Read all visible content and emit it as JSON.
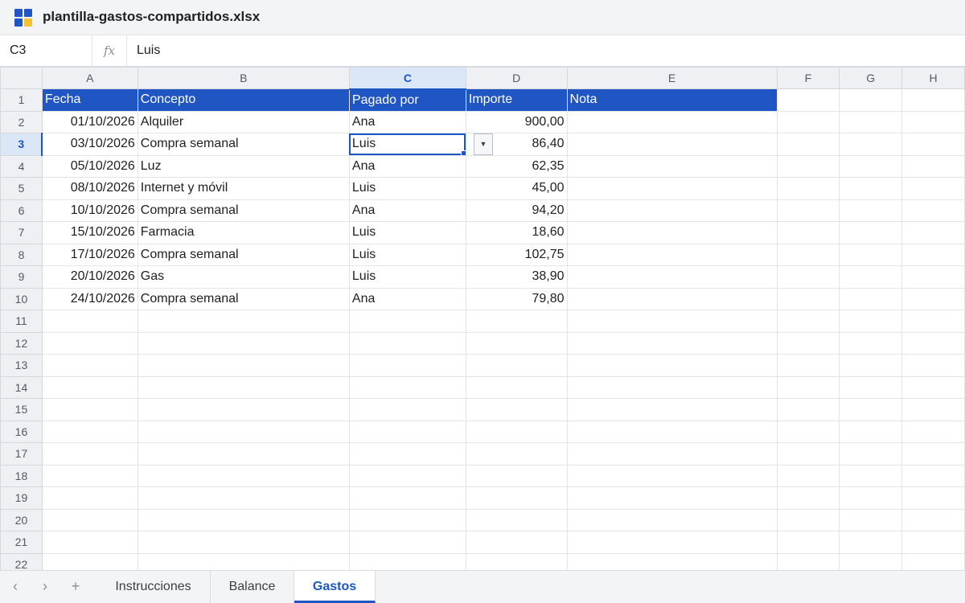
{
  "window": {
    "title": "plantilla-gastos-compartidos.xlsx",
    "logo_colors": [
      "#2055c4",
      "#2055c4",
      "#2055c4",
      "#f2c230"
    ]
  },
  "formula_bar": {
    "cell_ref": "C3",
    "fx_label": "fx",
    "value": "Luis"
  },
  "sheet": {
    "columns": [
      "A",
      "B",
      "C",
      "D",
      "E",
      "F",
      "G",
      "H"
    ],
    "active_column": "C",
    "active_row": 3,
    "header_row": [
      "Fecha",
      "Concepto",
      "Pagado por",
      "Importe",
      "Nota"
    ],
    "rows": [
      [
        "01/10/2026",
        "Alquiler",
        "Ana",
        "900,00",
        ""
      ],
      [
        "03/10/2026",
        "Compra semanal",
        "Luis",
        "86,40",
        ""
      ],
      [
        "05/10/2026",
        "Luz",
        "Ana",
        "62,35",
        ""
      ],
      [
        "08/10/2026",
        "Internet y móvil",
        "Luis",
        "45,00",
        ""
      ],
      [
        "10/10/2026",
        "Compra semanal",
        "Ana",
        "94,20",
        ""
      ],
      [
        "15/10/2026",
        "Farmacia",
        "Luis",
        "18,60",
        ""
      ],
      [
        "17/10/2026",
        "Compra semanal",
        "Luis",
        "102,75",
        ""
      ],
      [
        "20/10/2026",
        "Gas",
        "Luis",
        "38,90",
        ""
      ],
      [
        "24/10/2026",
        "Compra semanal",
        "Ana",
        "79,80",
        ""
      ]
    ],
    "row_numbers": [
      1,
      2,
      3,
      4,
      5,
      6,
      7,
      8,
      9,
      10,
      11,
      12,
      13,
      14,
      15,
      16,
      17,
      18,
      19,
      20,
      21,
      22
    ],
    "dropdown_glyph": "▼",
    "header_fill_color": "#2055c4"
  },
  "tabs": {
    "nav_prev": "‹",
    "nav_next": "›",
    "add": "+",
    "items": [
      "Instrucciones",
      "Balance",
      "Gastos"
    ],
    "active": "Gastos"
  }
}
